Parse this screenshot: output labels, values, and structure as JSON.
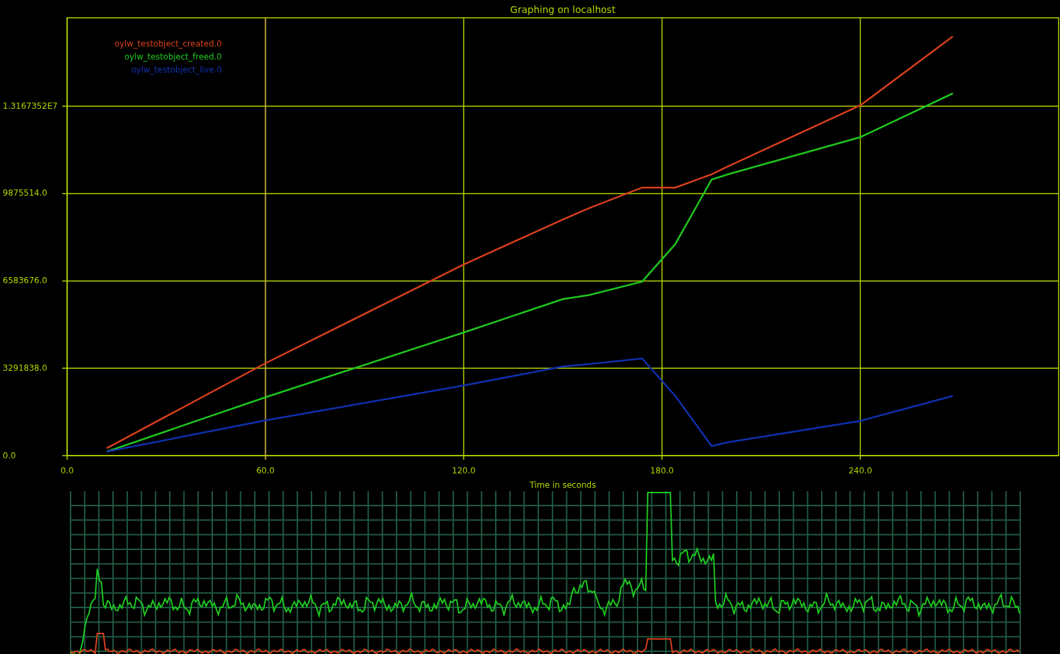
{
  "chart": {
    "chart_data": {
      "type": "line",
      "title": "Graphing on localhost",
      "xlabel": "Time in seconds",
      "grid": true,
      "ref_lines": [
        {
          "axis": "x",
          "value": 60,
          "color": "#c8a040"
        }
      ],
      "x": [
        12,
        60,
        120,
        150,
        158,
        174,
        184,
        195,
        200,
        240,
        268
      ],
      "series": [
        {
          "name": "oylw_testobject_created.0",
          "color": "#d8401c",
          "values": [
            280000,
            3480000,
            7200000,
            8900000,
            9330000,
            10100000,
            10100000,
            10600000,
            10900000,
            13200000,
            15800000
          ]
        },
        {
          "name": "oylw_testobject_freed.0",
          "color": "#1ec81e",
          "values": [
            150000,
            2200000,
            4640000,
            5900000,
            6050000,
            6560000,
            7970000,
            10400000,
            10600000,
            12000000,
            13650000
          ]
        },
        {
          "name": "oylw_testobject_live.0",
          "color": "#1030b0",
          "values": [
            150000,
            1330000,
            2640000,
            3360000,
            3450000,
            3660000,
            2250000,
            360000,
            500000,
            1310000,
            2250000
          ]
        }
      ],
      "xlim": [
        0,
        300
      ],
      "ylim": [
        0,
        16500000
      ],
      "xticks": [
        {
          "value": 0,
          "label": "0.0"
        },
        {
          "value": 60,
          "label": "60.0"
        },
        {
          "value": 120,
          "label": "120.0"
        },
        {
          "value": 180,
          "label": "180.0"
        },
        {
          "value": 240,
          "label": "240.0"
        }
      ],
      "yticks": [
        {
          "value": 0,
          "label": "0.0"
        },
        {
          "value": 3291838,
          "label": "3291838.0"
        },
        {
          "value": 6583676,
          "label": "6583676.0"
        },
        {
          "value": 9875514,
          "label": "9875514.0"
        },
        {
          "value": 13167352,
          "label": "1.3167352E7"
        }
      ]
    }
  }
}
